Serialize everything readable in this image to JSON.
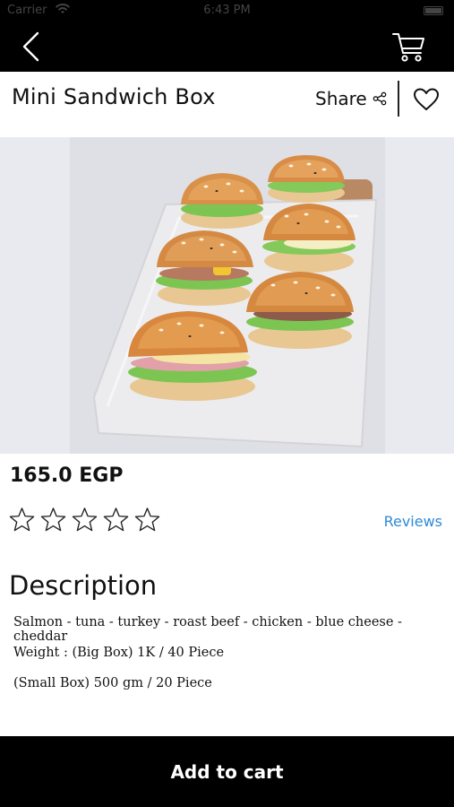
{
  "status_bar": {
    "carrier": "Carrier",
    "time": "6:43 PM"
  },
  "nav": {
    "back_icon": "chevron-left-icon",
    "cart_icon": "cart-icon"
  },
  "product": {
    "title": "Mini Sandwich Box",
    "share_label": "Share",
    "price": "165.0 EGP",
    "rating_stars": 0,
    "rating_max": 5,
    "reviews_label": "Reviews"
  },
  "description": {
    "heading": "Description",
    "lines": [
      "Salmon - tuna - turkey - roast beef - chicken - blue cheese - cheddar",
      "Weight : (Big Box) 1K / 40 Piece",
      "(Small Box) 500 gm / 20 Piece"
    ]
  },
  "footer": {
    "add_to_cart_label": "Add to cart"
  },
  "colors": {
    "bar_background": "#000000",
    "link": "#2d8ad8",
    "image_background": "#e8e8ee"
  }
}
